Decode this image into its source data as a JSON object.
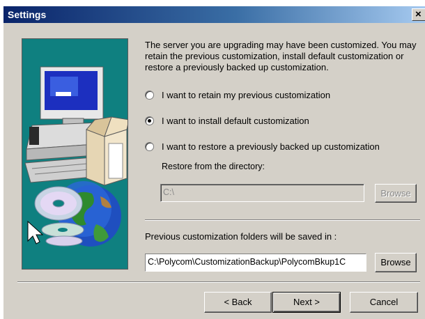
{
  "window": {
    "title": "Settings",
    "close_glyph": "×"
  },
  "intro_text": "The server you are upgrading may have been customized. You may retain the previous customization, install default customization or restore a previously backed up customization.",
  "options": [
    {
      "label": "I want to retain my previous customization",
      "selected": false
    },
    {
      "label": "I want to install default customization",
      "selected": true
    },
    {
      "label": "I want to restore a previously backed up customization",
      "selected": false
    }
  ],
  "restore": {
    "label": "Restore from the directory:",
    "value": "C:\\",
    "browse_label": "Browse",
    "enabled": false
  },
  "save": {
    "label": "Previous customization folders will be saved in :",
    "value": "C:\\Polycom\\CustomizationBackup\\PolycomBkup1C",
    "browse_label": "Browse"
  },
  "footer": {
    "back_label": "< Back",
    "next_label": "Next >",
    "cancel_label": "Cancel"
  },
  "colors": {
    "title_bar_start": "#0a246a",
    "title_bar_end": "#a6caf0",
    "dialog_face": "#d4d0c8",
    "art_background": "#0f8080"
  },
  "icons": [
    "computer-icon",
    "box-icon",
    "cd-disc-icon",
    "globe-icon",
    "mouse-cursor-icon"
  ]
}
